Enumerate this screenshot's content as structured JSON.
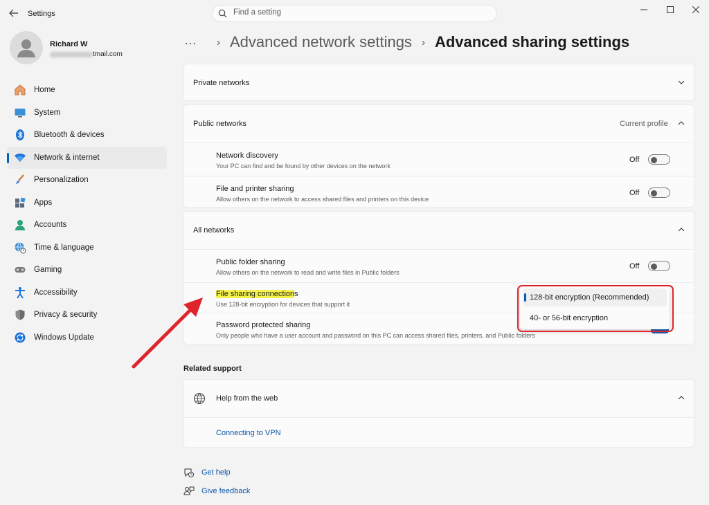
{
  "window": {
    "title": "Settings",
    "back_icon": "back-arrow-icon",
    "controls": [
      "minimize-icon",
      "maximize-icon",
      "close-icon"
    ]
  },
  "search": {
    "placeholder": "Find a setting"
  },
  "profile": {
    "name": "Richard W",
    "email_visible": "tmail.com"
  },
  "nav": {
    "items": [
      {
        "label": "Home",
        "icon": "home-icon"
      },
      {
        "label": "System",
        "icon": "system-icon"
      },
      {
        "label": "Bluetooth & devices",
        "icon": "bluetooth-icon"
      },
      {
        "label": "Network & internet",
        "icon": "wifi-icon",
        "active": true
      },
      {
        "label": "Personalization",
        "icon": "brush-icon"
      },
      {
        "label": "Apps",
        "icon": "apps-icon"
      },
      {
        "label": "Accounts",
        "icon": "accounts-icon"
      },
      {
        "label": "Time & language",
        "icon": "globe-clock-icon"
      },
      {
        "label": "Gaming",
        "icon": "gamepad-icon"
      },
      {
        "label": "Accessibility",
        "icon": "accessibility-icon"
      },
      {
        "label": "Privacy & security",
        "icon": "shield-icon"
      },
      {
        "label": "Windows Update",
        "icon": "update-icon"
      }
    ]
  },
  "breadcrumb": {
    "overflow": "…",
    "parent": "Advanced network settings",
    "current": "Advanced sharing settings"
  },
  "private_networks": {
    "title": "Private networks"
  },
  "public_networks": {
    "title": "Public networks",
    "badge": "Current profile",
    "network_discovery": {
      "title": "Network discovery",
      "desc": "Your PC can find and be found by other devices on the network",
      "state": "Off"
    },
    "file_printer_sharing": {
      "title": "File and printer sharing",
      "desc": "Allow others on the network to access shared files and printers on this device",
      "state": "Off"
    }
  },
  "all_networks": {
    "title": "All networks",
    "public_folder_sharing": {
      "title": "Public folder sharing",
      "desc": "Allow others on the network to read and write files in Public folders",
      "state": "Off"
    },
    "file_sharing_connections": {
      "title_highlighted": "File sharing connection",
      "title_rest": "s",
      "desc": "Use 128-bit encryption for devices that support it",
      "options": [
        "128-bit encryption (Recommended)",
        "40- or 56-bit encryption"
      ],
      "selected": "128-bit encryption (Recommended)"
    },
    "password_protected_sharing": {
      "title": "Password protected sharing",
      "desc": "Only people who have a user account and password on this PC can access shared files, printers, and Public folders"
    }
  },
  "related_support": {
    "title": "Related support",
    "help_from_web": "Help from the web",
    "link": "Connecting to VPN"
  },
  "footer": {
    "get_help": "Get help",
    "give_feedback": "Give feedback"
  },
  "colors": {
    "accent": "#005fb8",
    "annotation": "#e0242c",
    "highlight": "#f3f14a"
  }
}
